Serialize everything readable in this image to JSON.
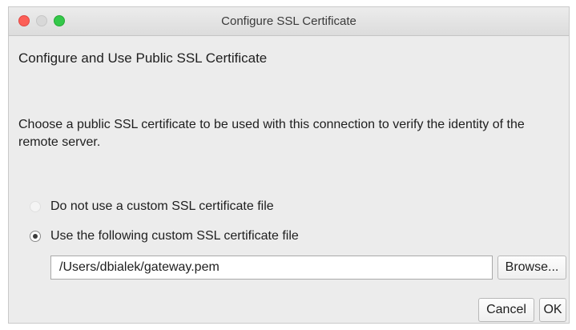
{
  "window": {
    "title": "Configure SSL Certificate"
  },
  "heading": "Configure and Use Public SSL Certificate",
  "description": "Choose a public SSL certificate to be used with this connection to verify the identity of the remote server.",
  "options": [
    {
      "label": "Do not use a custom SSL certificate file",
      "selected": false
    },
    {
      "label": "Use the following custom SSL certificate file",
      "selected": true
    }
  ],
  "certificate_path": {
    "value": "/Users/dbialek/gateway.pem"
  },
  "buttons": {
    "browse": "Browse...",
    "cancel": "Cancel",
    "ok": "OK"
  },
  "colors": {
    "close": "#fc5f57",
    "minimize": "#d8d8d8",
    "maximize": "#34c84a",
    "window_background": "#ececec"
  }
}
